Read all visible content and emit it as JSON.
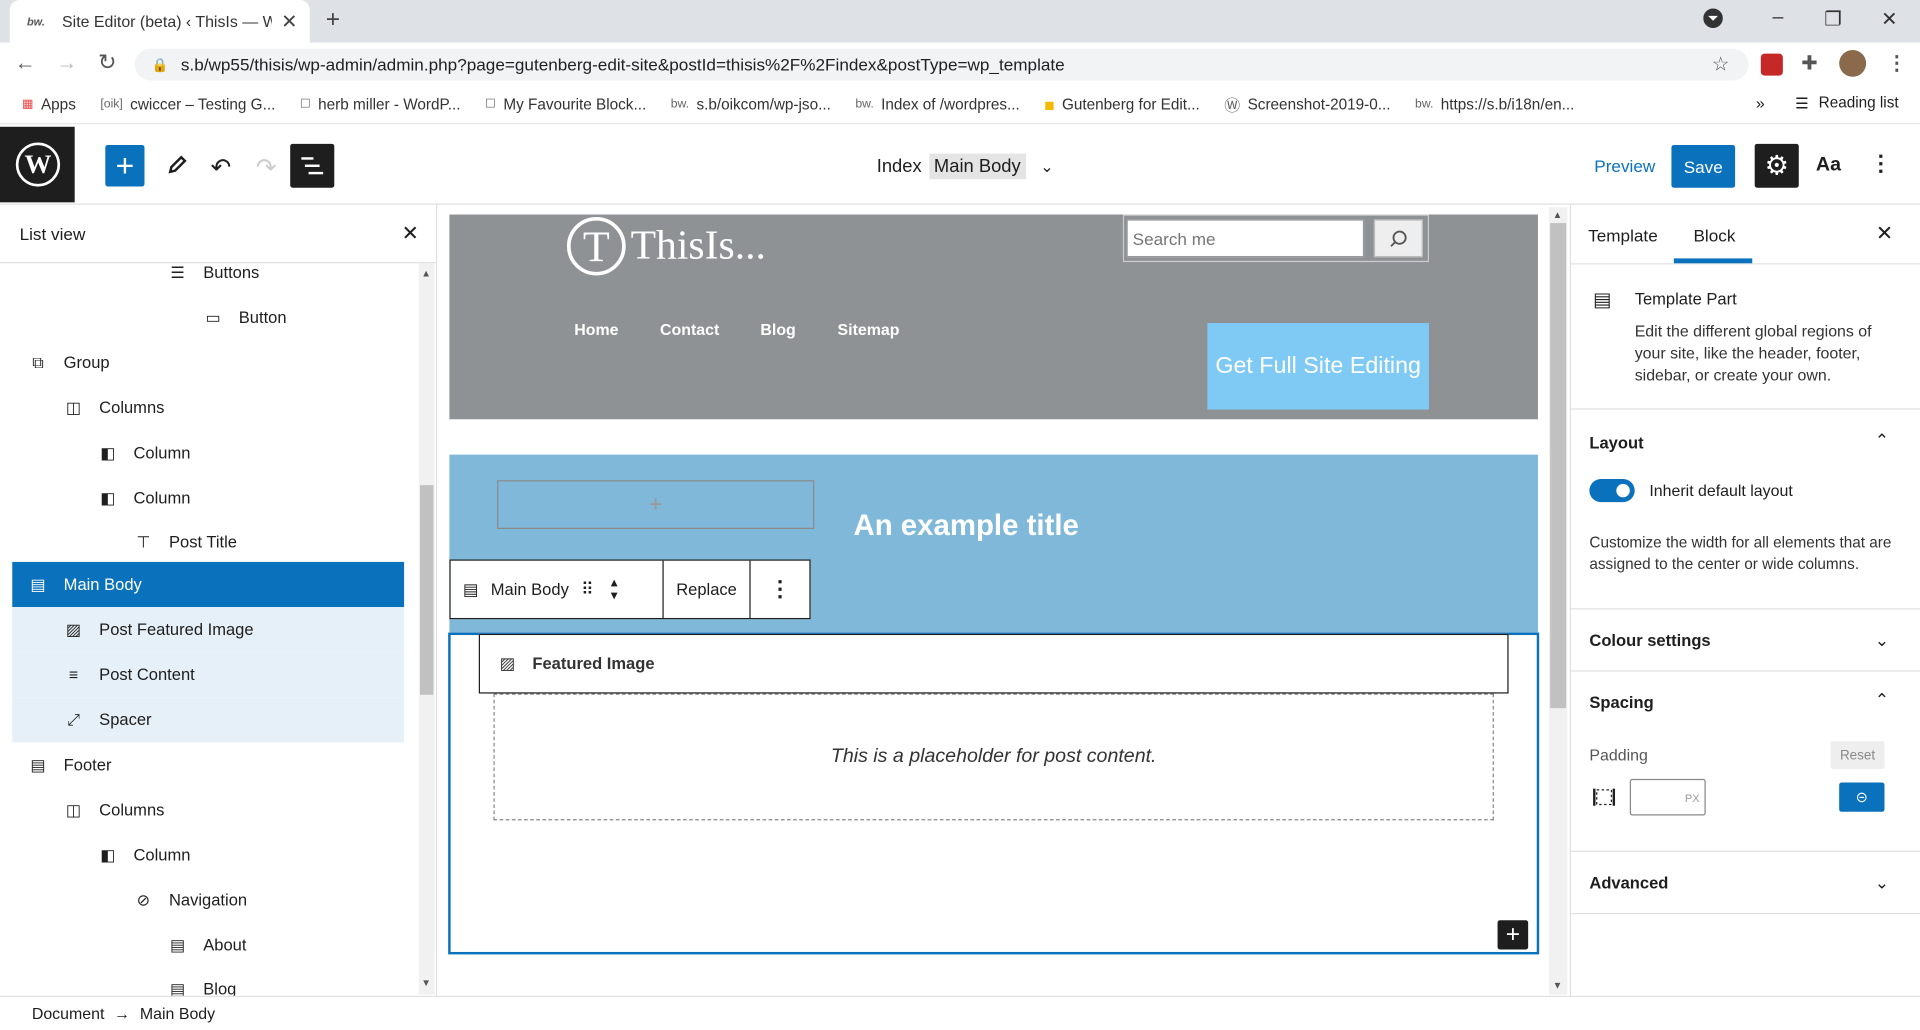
{
  "browser": {
    "tab_title": "Site Editor (beta) ‹ ThisIs — Wc",
    "tab_favicon": "bw.",
    "url": "s.b/wp55/thisis/wp-admin/admin.php?page=gutenberg-edit-site&postId=thisis%2F%2Findex&postType=wp_template",
    "bookmarks": [
      {
        "label": "Apps",
        "icon": "apps-icon"
      },
      {
        "label": "cwiccer – Testing G...",
        "icon": "oik-icon"
      },
      {
        "label": "herb miller - WordP...",
        "icon": "page-icon"
      },
      {
        "label": "My Favourite Block...",
        "icon": "page-icon"
      },
      {
        "label": "s.b/oikcom/wp-jso...",
        "icon": "bw-icon"
      },
      {
        "label": "Index of /wordpres...",
        "icon": "bw-icon"
      },
      {
        "label": "Gutenberg for Edit...",
        "icon": "folder-icon"
      },
      {
        "label": "Screenshot-2019-0...",
        "icon": "wordpress-icon"
      },
      {
        "label": "https://s.b/i18n/en...",
        "icon": "bw-icon"
      }
    ],
    "reading_list": "Reading list"
  },
  "editor": {
    "doc_title": "Index",
    "doc_part": "Main Body",
    "preview": "Preview",
    "save": "Save",
    "styles": "Aa"
  },
  "listview": {
    "title": "List view",
    "items": [
      {
        "label": "Buttons",
        "icon": "buttons-icon",
        "indent": 2
      },
      {
        "label": "Button",
        "icon": "button-icon",
        "indent": 3
      },
      {
        "label": "Group",
        "icon": "group-icon",
        "indent": 0
      },
      {
        "label": "Columns",
        "icon": "columns-icon",
        "indent": 1
      },
      {
        "label": "Column",
        "icon": "column-icon",
        "indent": 2
      },
      {
        "label": "Column",
        "icon": "column-icon",
        "indent": 2
      },
      {
        "label": "Post Title",
        "icon": "post-title-icon",
        "indent": 3
      },
      {
        "label": "Main Body",
        "icon": "template-part-icon",
        "indent": 0,
        "state": "selected"
      },
      {
        "label": "Post Featured Image",
        "icon": "featured-image-icon",
        "indent": 1,
        "state": "child"
      },
      {
        "label": "Post Content",
        "icon": "post-content-icon",
        "indent": 1,
        "state": "child"
      },
      {
        "label": "Spacer",
        "icon": "spacer-icon",
        "indent": 1,
        "state": "child"
      },
      {
        "label": "Footer",
        "icon": "template-part-icon",
        "indent": 0
      },
      {
        "label": "Columns",
        "icon": "columns-icon",
        "indent": 1
      },
      {
        "label": "Column",
        "icon": "column-icon",
        "indent": 2
      },
      {
        "label": "Navigation",
        "icon": "navigation-icon",
        "indent": 3
      },
      {
        "label": "About",
        "icon": "page-icon",
        "indent": 4
      },
      {
        "label": "Blog",
        "icon": "page-icon",
        "indent": 4
      }
    ]
  },
  "canvas": {
    "site_logo_letter": "T",
    "site_title": "ThisIs...",
    "search_placeholder": "Search me",
    "nav": [
      "Home",
      "Contact",
      "Blog",
      "Sitemap"
    ],
    "cta": "Get Full Site Editing",
    "example_title": "An example title",
    "toolbar": {
      "block": "Main Body",
      "replace": "Replace"
    },
    "featured_image": "Featured Image",
    "placeholder": "This is a placeholder for post content."
  },
  "sidebar": {
    "tab_template": "Template",
    "tab_block": "Block",
    "block_name": "Template Part",
    "block_desc": "Edit the different global regions of your site, like the header, footer, sidebar, or create your own.",
    "layout_title": "Layout",
    "inherit_label": "Inherit default layout",
    "inherit_on": true,
    "layout_desc": "Customize the width for all elements that are assigned to the center or wide columns.",
    "colour_title": "Colour settings",
    "spacing_title": "Spacing",
    "padding_label": "Padding",
    "reset": "Reset",
    "padding_unit": "PX",
    "advanced_title": "Advanced"
  },
  "breadcrumb": {
    "root": "Document",
    "arrow": "→",
    "current": "Main Body"
  },
  "colors": {
    "accent": "#0a71bd",
    "header_bg": "#8e9295",
    "title_bg": "#7fb8d9",
    "cta_bg": "#7fc9f5"
  }
}
